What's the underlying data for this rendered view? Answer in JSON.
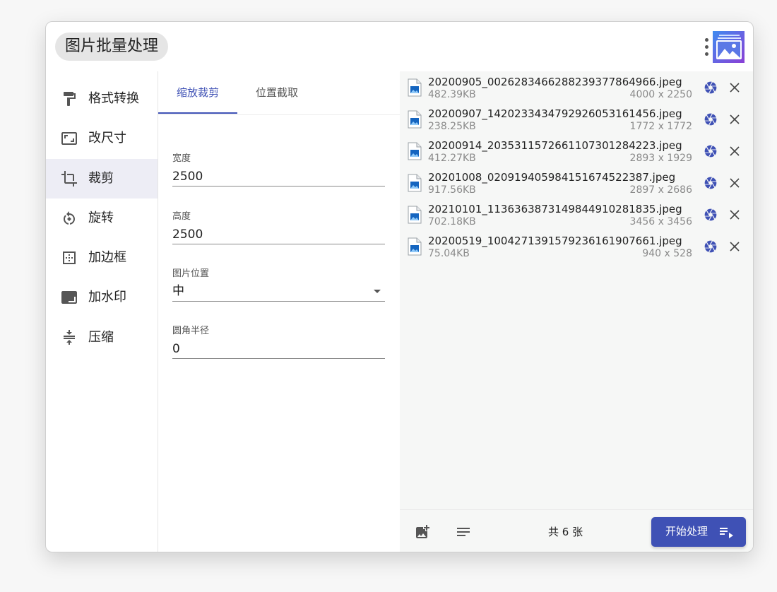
{
  "app": {
    "title": "图片批量处理"
  },
  "sidebar": {
    "items": [
      {
        "label": "格式转换",
        "icon": "paint-roller-icon",
        "active": false
      },
      {
        "label": "改尺寸",
        "icon": "aspect-ratio-icon",
        "active": false
      },
      {
        "label": "裁剪",
        "icon": "crop-icon",
        "active": true
      },
      {
        "label": "旋转",
        "icon": "rotate-icon",
        "active": false
      },
      {
        "label": "加边框",
        "icon": "border-icon",
        "active": false
      },
      {
        "label": "加水印",
        "icon": "watermark-icon",
        "active": false
      },
      {
        "label": "压缩",
        "icon": "compress-icon",
        "active": false
      }
    ]
  },
  "tabs": [
    {
      "label": "缩放裁剪",
      "active": true
    },
    {
      "label": "位置截取",
      "active": false
    }
  ],
  "form": {
    "width": {
      "label": "宽度",
      "value": "2500"
    },
    "height": {
      "label": "高度",
      "value": "2500"
    },
    "position": {
      "label": "图片位置",
      "value": "中"
    },
    "radius": {
      "label": "圆角半径",
      "value": "0"
    }
  },
  "files": [
    {
      "name": "20200905_002628346628823937786496​6.jpeg",
      "size": "482.39KB",
      "dims": "4000 x 2250"
    },
    {
      "name": "20200907_142023343479292605316145​6.jpeg",
      "size": "238.25KB",
      "dims": "1772 x 1772"
    },
    {
      "name": "20200914_203531157266110730128422​3.jpeg",
      "size": "412.27KB",
      "dims": "2893 x 1929"
    },
    {
      "name": "20201008_020919405984151674522387.jpeg",
      "size": "917.56KB",
      "dims": "2897 x 2686"
    },
    {
      "name": "20210101_113636387314984491028183​5.jpeg",
      "size": "702.18KB",
      "dims": "3456 x 3456"
    },
    {
      "name": "20200519_100427139157923616190766​1.jpeg",
      "size": "75.04KB",
      "dims": "940 x 528"
    }
  ],
  "footer": {
    "count_text": "共 6 张",
    "start_label": "开始处理"
  },
  "colors": {
    "accent": "#3f51b5",
    "panel": "#f6f7f6",
    "active_nav": "#ededf5"
  }
}
